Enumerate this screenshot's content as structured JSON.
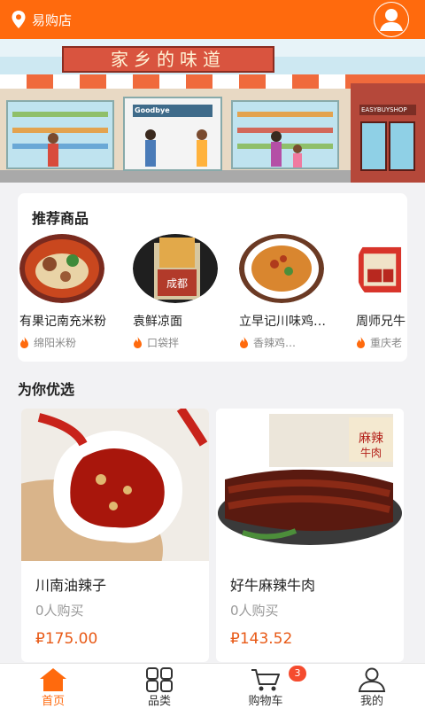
{
  "header": {
    "store_name": "易购店",
    "location_icon": "location-pin-icon",
    "avatar_icon": "user-avatar-icon"
  },
  "banner": {
    "title": "家乡的味道",
    "shop_sign": "EASYBUYSHOP",
    "entrance_sign": "Goodbye"
  },
  "recommend": {
    "title": "推荐商品",
    "items": [
      {
        "name": "有果记南充米粉",
        "tag": "绵阳米粉"
      },
      {
        "name": "袁鲜凉面",
        "tag": "口袋拌"
      },
      {
        "name": "立早记川味鸡…",
        "tag": "香辣鸡…"
      },
      {
        "name": "周师兄牛",
        "tag": "重庆老"
      }
    ]
  },
  "for_you": {
    "title": "为你优选",
    "products": [
      {
        "name": "川南油辣子",
        "sold": "0人购买",
        "price": "₽175.00"
      },
      {
        "name": "好牛麻辣牛肉",
        "sold": "0人购买",
        "price": "₽143.52"
      }
    ]
  },
  "tabbar": {
    "tabs": [
      {
        "label": "首页",
        "icon": "home-icon",
        "active": true
      },
      {
        "label": "品类",
        "icon": "grid-icon",
        "active": false
      },
      {
        "label": "购物车",
        "icon": "cart-icon",
        "active": false,
        "badge": "3"
      },
      {
        "label": "我的",
        "icon": "user-icon",
        "active": false
      }
    ]
  },
  "colors": {
    "accent": "#ff6a0d",
    "price": "#e85a17",
    "badge": "#f54b2e"
  }
}
